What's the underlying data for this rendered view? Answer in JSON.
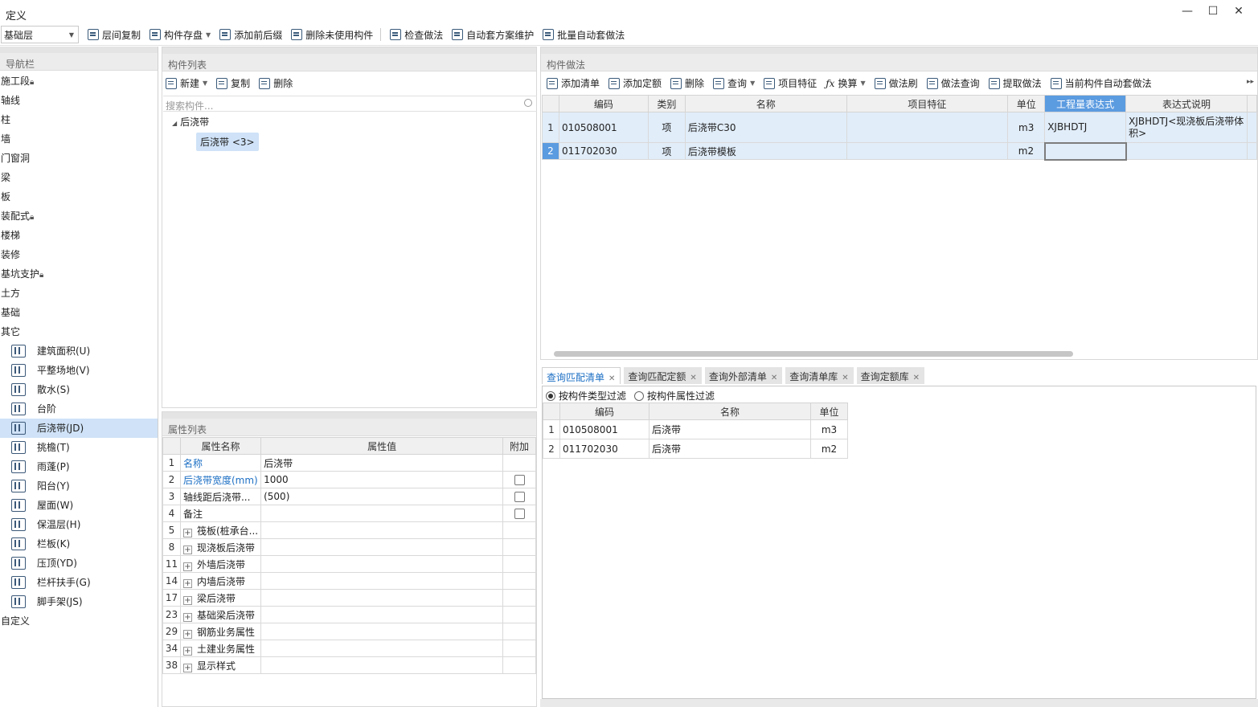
{
  "window": {
    "title": "定义",
    "controls": [
      "—",
      "☐",
      "✕"
    ]
  },
  "toolbar": {
    "floor": "基础层",
    "buttons": [
      "层间复制",
      "构件存盘",
      "添加前后缀",
      "删除未使用构件",
      "检查做法",
      "自动套方案维护",
      "批量自动套做法"
    ]
  },
  "nav": {
    "title": "导航栏",
    "items": [
      {
        "label": "施工段",
        "lock": true
      },
      {
        "label": "轴线"
      },
      {
        "label": "柱"
      },
      {
        "label": "墙"
      },
      {
        "label": "门窗洞"
      },
      {
        "label": "梁"
      },
      {
        "label": "板"
      },
      {
        "label": "装配式",
        "lock": true
      },
      {
        "label": "楼梯"
      },
      {
        "label": "装修"
      },
      {
        "label": "基坑支护",
        "lock": true
      },
      {
        "label": "土方"
      },
      {
        "label": "基础"
      },
      {
        "label": "其它"
      }
    ],
    "sub_items": [
      {
        "label": "建筑面积(U)",
        "icon": "building-area-icon"
      },
      {
        "label": "平整场地(V)",
        "icon": "site-leveling-icon"
      },
      {
        "label": "散水(S)",
        "icon": "apron-icon"
      },
      {
        "label": "台阶",
        "icon": "steps-icon"
      },
      {
        "label": "后浇带(JD)",
        "icon": "post-pour-strip-icon",
        "selected": true
      },
      {
        "label": "挑檐(T)",
        "icon": "cornice-icon"
      },
      {
        "label": "雨蓬(P)",
        "icon": "canopy-icon"
      },
      {
        "label": "阳台(Y)",
        "icon": "balcony-icon"
      },
      {
        "label": "屋面(W)",
        "icon": "roof-icon"
      },
      {
        "label": "保温层(H)",
        "icon": "insulation-icon"
      },
      {
        "label": "栏板(K)",
        "icon": "parapet-icon"
      },
      {
        "label": "压顶(YD)",
        "icon": "coping-icon"
      },
      {
        "label": "栏杆扶手(G)",
        "icon": "railing-icon"
      },
      {
        "label": "脚手架(JS)",
        "icon": "scaffold-icon"
      }
    ],
    "last_item": "自定义"
  },
  "complist": {
    "title": "构件列表",
    "buttons": [
      "新建",
      "复制",
      "删除"
    ],
    "search_placeholder": "搜索构件...",
    "tree_root": "后浇带",
    "tree_leaf": "后浇带 <3>"
  },
  "proplist": {
    "title": "属性列表",
    "headers": [
      "属性名称",
      "属性值",
      "附加"
    ],
    "rows": [
      {
        "n": "1",
        "name": "名称",
        "value": "后浇带",
        "blue": true,
        "check": false,
        "expand": false
      },
      {
        "n": "2",
        "name": "后浇带宽度(mm)",
        "value": "1000",
        "blue": true,
        "check": true,
        "expand": false
      },
      {
        "n": "3",
        "name": "轴线距后浇带...",
        "value": "(500)",
        "blue": false,
        "check": true,
        "expand": false
      },
      {
        "n": "4",
        "name": "备注",
        "value": "",
        "blue": false,
        "check": true,
        "expand": false
      },
      {
        "n": "5",
        "name": "筏板(桩承台...",
        "value": "",
        "blue": false,
        "check": false,
        "expand": true
      },
      {
        "n": "8",
        "name": "现浇板后浇带",
        "value": "",
        "blue": false,
        "check": false,
        "expand": true
      },
      {
        "n": "11",
        "name": "外墙后浇带",
        "value": "",
        "blue": false,
        "check": false,
        "expand": true
      },
      {
        "n": "14",
        "name": "内墙后浇带",
        "value": "",
        "blue": false,
        "check": false,
        "expand": true
      },
      {
        "n": "17",
        "name": "梁后浇带",
        "value": "",
        "blue": false,
        "check": false,
        "expand": true
      },
      {
        "n": "23",
        "name": "基础梁后浇带",
        "value": "",
        "blue": false,
        "check": false,
        "expand": true
      },
      {
        "n": "29",
        "name": "钢筋业务属性",
        "value": "",
        "blue": false,
        "check": false,
        "expand": true
      },
      {
        "n": "34",
        "name": "土建业务属性",
        "value": "",
        "blue": false,
        "check": false,
        "expand": true
      },
      {
        "n": "38",
        "name": "显示样式",
        "value": "",
        "blue": false,
        "check": false,
        "expand": true
      }
    ]
  },
  "method": {
    "title": "构件做法",
    "buttons": [
      "添加清单",
      "添加定额",
      "删除",
      "查询",
      "项目特征",
      "换算",
      "做法刷",
      "做法查询",
      "提取做法",
      "当前构件自动套做法"
    ],
    "headers": [
      "编码",
      "类别",
      "名称",
      "项目特征",
      "单位",
      "工程量表达式",
      "表达式说明"
    ],
    "rows": [
      {
        "n": "1",
        "code": "010508001",
        "type": "项",
        "name": "后浇带C30",
        "feature": "",
        "unit": "m3",
        "expr": "XJBHDTJ",
        "desc": "XJBHDTJ<现浇板后浇带体积>"
      },
      {
        "n": "2",
        "code": "011702030",
        "type": "项",
        "name": "后浇带模板",
        "feature": "",
        "unit": "m2",
        "expr": "",
        "desc": ""
      }
    ]
  },
  "query": {
    "tabs": [
      "查询匹配清单",
      "查询匹配定额",
      "查询外部清单",
      "查询清单库",
      "查询定额库"
    ],
    "filters": [
      "按构件类型过滤",
      "按构件属性过滤"
    ],
    "headers": [
      "编码",
      "名称",
      "单位"
    ],
    "rows": [
      {
        "n": "1",
        "code": "010508001",
        "name": "后浇带",
        "unit": "m3"
      },
      {
        "n": "2",
        "code": "011702030",
        "name": "后浇带",
        "unit": "m2"
      }
    ]
  }
}
